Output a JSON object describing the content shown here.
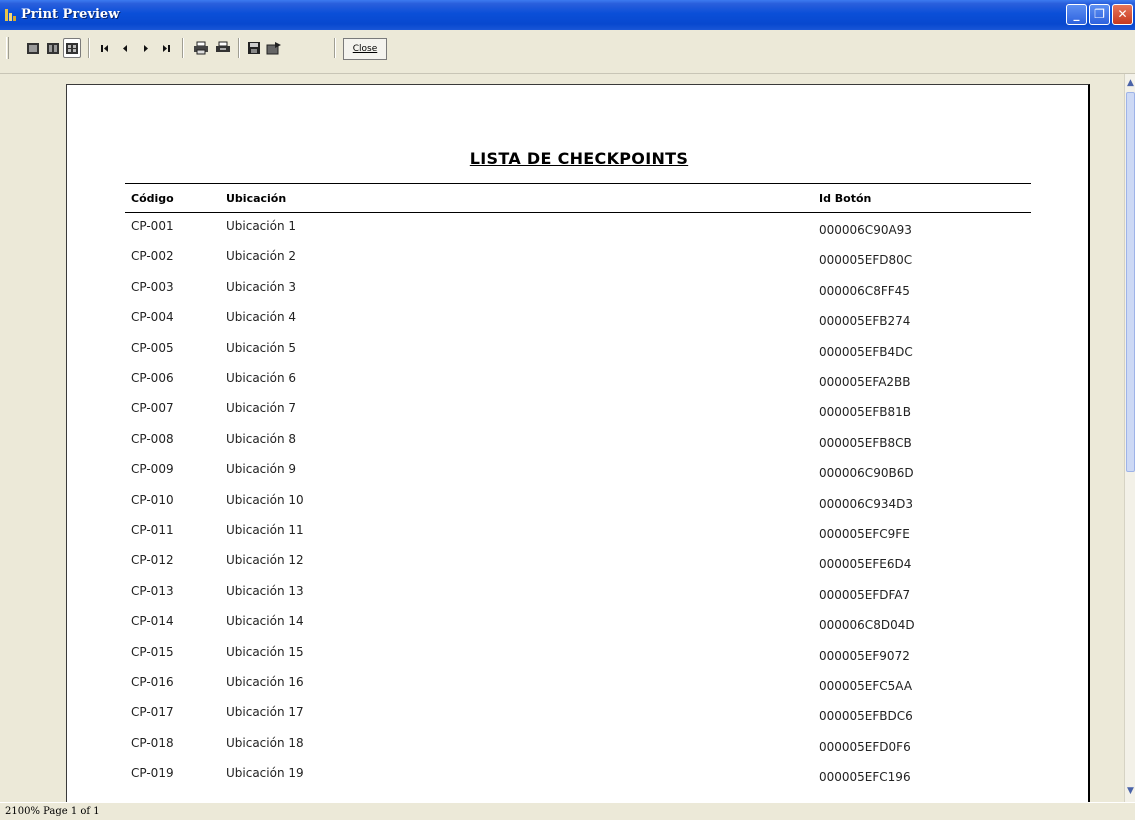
{
  "window": {
    "title": "Print Preview",
    "minimize_glyph": "_",
    "maximize_glyph": "❐",
    "close_glyph": "✕"
  },
  "toolbar": {
    "close_label": "Close",
    "icons": [
      "one-page-icon",
      "two-page-icon",
      "multi-page-icon",
      "first-page-icon",
      "prev-page-icon",
      "next-page-icon",
      "last-page-icon",
      "print-icon",
      "print-setup-icon",
      "save-icon",
      "export-icon"
    ]
  },
  "report": {
    "title": "LISTA DE CHECKPOINTS",
    "columns": [
      "Código",
      "Ubicación",
      "Id Botón"
    ],
    "rows": [
      [
        "CP-001",
        "Ubicación 1",
        "000006C90A93"
      ],
      [
        "CP-002",
        "Ubicación 2",
        "000005EFD80C"
      ],
      [
        "CP-003",
        "Ubicación 3",
        "000006C8FF45"
      ],
      [
        "CP-004",
        "Ubicación 4",
        "000005EFB274"
      ],
      [
        "CP-005",
        "Ubicación 5",
        "000005EFB4DC"
      ],
      [
        "CP-006",
        "Ubicación 6",
        "000005EFA2BB"
      ],
      [
        "CP-007",
        "Ubicación 7",
        "000005EFB81B"
      ],
      [
        "CP-008",
        "Ubicación 8",
        "000005EFB8CB"
      ],
      [
        "CP-009",
        "Ubicación 9",
        "000006C90B6D"
      ],
      [
        "CP-010",
        "Ubicación 10",
        "000006C934D3"
      ],
      [
        "CP-011",
        "Ubicación 11",
        "000005EFC9FE"
      ],
      [
        "CP-012",
        "Ubicación 12",
        "000005EFE6D4"
      ],
      [
        "CP-013",
        "Ubicación 13",
        "000005EFDFA7"
      ],
      [
        "CP-014",
        "Ubicación 14",
        "000006C8D04D"
      ],
      [
        "CP-015",
        "Ubicación 15",
        "000005EF9072"
      ],
      [
        "CP-016",
        "Ubicación 16",
        "000005EFC5AA"
      ],
      [
        "CP-017",
        "Ubicación 17",
        "000005EFBDC6"
      ],
      [
        "CP-018",
        "Ubicación 18",
        "000005EFD0F6"
      ],
      [
        "CP-019",
        "Ubicación 19",
        "000005EFC196"
      ]
    ]
  },
  "status": {
    "text": "2100% Page 1 of 1"
  },
  "colors": {
    "titlebar": "#0a4fd8",
    "chrome": "#ece9d8",
    "page": "#ffffff"
  }
}
